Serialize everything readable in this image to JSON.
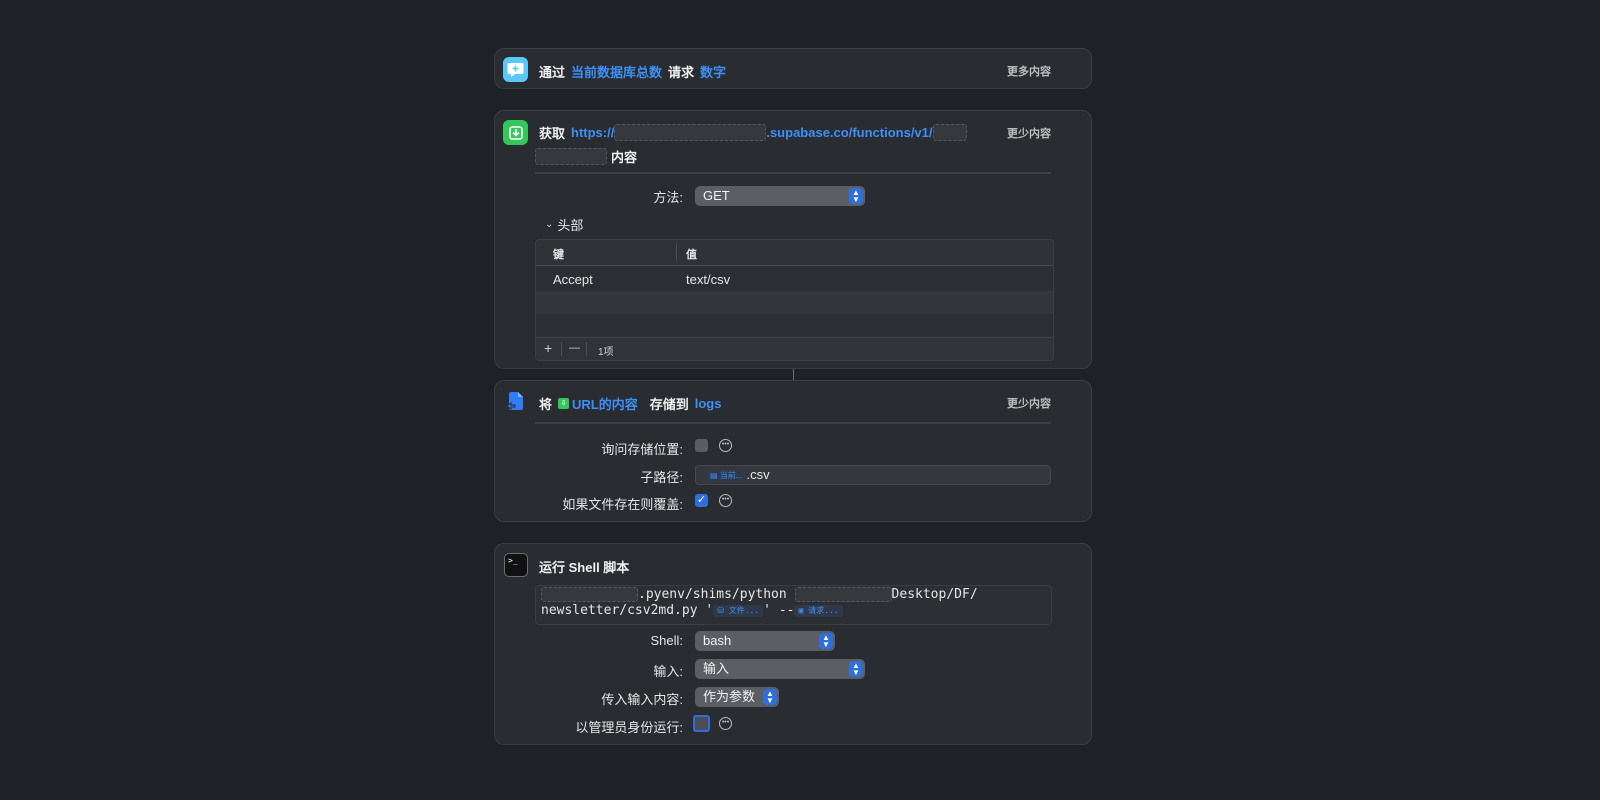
{
  "ask_action": {
    "prefix": "通过",
    "variable": "当前数据库总数",
    "middle": "请求",
    "type": "数字",
    "toggle": "更多内容"
  },
  "get_action": {
    "prefix": "获取",
    "url_prefix": "https://",
    "url_domain": ".supabase.co/functions/v1/",
    "suffix": "内容",
    "toggle": "更少内容",
    "method_label": "方法:",
    "method_value": "GET",
    "headers_label": "头部",
    "table": {
      "col_key": "键",
      "col_value": "值",
      "rows": [
        {
          "key": "Accept",
          "value": "text/csv"
        }
      ]
    },
    "add_label": "+",
    "remove_label": "—",
    "count": "1项"
  },
  "save_action": {
    "prefix": "将",
    "variable": "URL的内容",
    "middle": "存储到",
    "folder": "logs",
    "toggle": "更少内容",
    "ask_label": "询问存储位置:",
    "subpath_label": "子路径:",
    "subpath_chip": "当前...",
    "subpath_suffix": ".csv",
    "overwrite_label": "如果文件存在则覆盖:",
    "ask_checked": false,
    "overwrite_checked": true
  },
  "shell_action": {
    "title": "运行 Shell 脚本",
    "script_part1": ".pyenv/shims/python",
    "script_part2": "Desktop/DF/",
    "script_line2_a": "newsletter/csv2md.py '",
    "chip_file": "文件...",
    "script_line2_b": "' --",
    "chip_request": "请求...",
    "shell_label": "Shell:",
    "shell_value": "bash",
    "input_label": "输入:",
    "input_value": "输入",
    "pass_label": "传入输入内容:",
    "pass_value": "作为参数",
    "admin_label": "以管理员身份运行:"
  },
  "colors": {
    "background": "#1e2227",
    "card": "#292c31",
    "accent": "#3d8ff5",
    "ask_icon": "#5ac8fa",
    "get_icon": "#34c759"
  }
}
